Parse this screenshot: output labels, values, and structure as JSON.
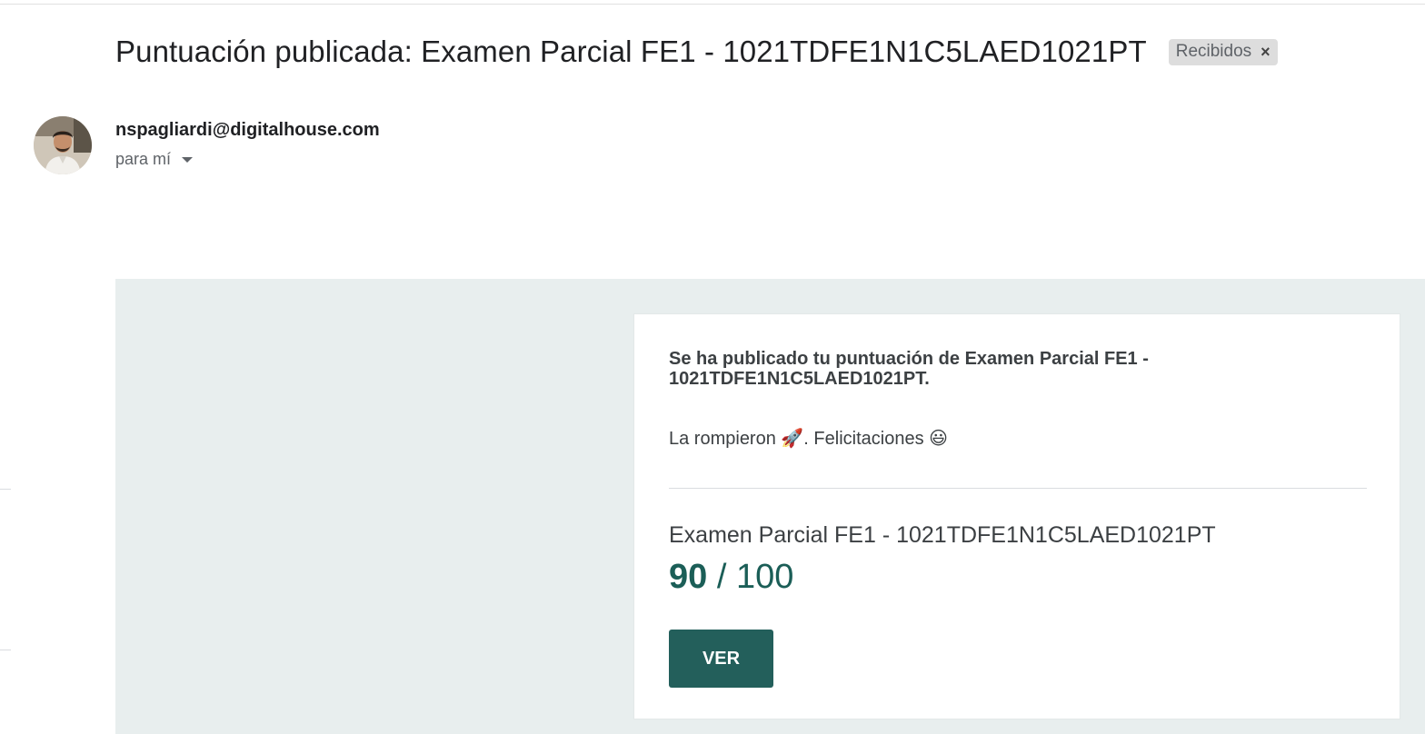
{
  "email": {
    "subject": "Puntuación publicada: Examen Parcial FE1 - 1021TDFE1N1C5LAED1021PT",
    "label": "Recibidos",
    "label_close": "×",
    "sender": "nspagliardi@digitalhouse.com",
    "recipient": "para mí"
  },
  "card": {
    "headline": "Se ha publicado tu puntuación de Examen Parcial FE1 - 1021TDFE1N1C5LAED1021PT.",
    "message": "La rompieron 🚀. Felicitaciones 😃",
    "exam_name": "Examen Parcial FE1 - 1021TDFE1N1C5LAED1021PT",
    "score": "90",
    "score_separator": " / ",
    "score_max": "100",
    "button_label": "VER"
  },
  "colors": {
    "accent": "#235f5b",
    "score": "#1b5e57",
    "body_background": "#e8eeee"
  }
}
